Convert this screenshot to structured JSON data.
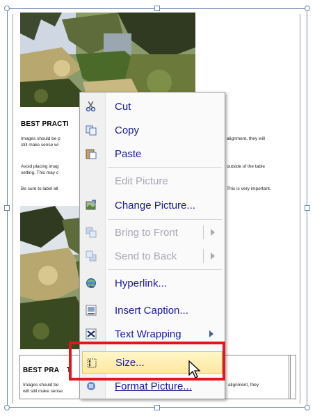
{
  "document": {
    "heading_top": "BEST PRACTI",
    "text_lines_top_left": [
      "Images should be p",
      "still make sense wi",
      "Avoid placing imag",
      "setting. This may c",
      "Be sure to label all"
    ],
    "text_lines_top_right": [
      "alignment, they will",
      "outside of the table",
      "This is very important."
    ],
    "heading_bottom": "BEST PRA",
    "heading_bottom_cell": "T",
    "text_lines_bottom_left": [
      "Images should be",
      "will still make sense"
    ],
    "text_lines_bottom_right": [
      "alignment, they"
    ]
  },
  "context_menu": {
    "items": [
      {
        "label": "Cut",
        "icon": "scissors-icon",
        "enabled": true
      },
      {
        "label": "Copy",
        "icon": "copy-icon",
        "enabled": true
      },
      {
        "label": "Paste",
        "icon": "paste-icon",
        "enabled": true
      },
      {
        "label": "Edit Picture",
        "icon": "",
        "enabled": false
      },
      {
        "label": "Change Picture...",
        "icon": "change-picture-icon",
        "enabled": true
      },
      {
        "label": "Bring to Front",
        "icon": "bring-to-front-icon",
        "enabled": false
      },
      {
        "label": "Send to Back",
        "icon": "send-to-back-icon",
        "enabled": false
      },
      {
        "label": "Hyperlink...",
        "icon": "hyperlink-globe-icon",
        "enabled": true
      },
      {
        "label": "Insert Caption...",
        "icon": "insert-caption-icon",
        "enabled": true
      },
      {
        "label": "Text Wrapping",
        "icon": "text-wrapping-icon",
        "enabled": true
      },
      {
        "label": "Size...",
        "icon": "size-icon",
        "enabled": true,
        "highlighted": true
      },
      {
        "label": "Format Picture...",
        "icon": "format-picture-icon",
        "enabled": true
      }
    ]
  },
  "colors": {
    "menu_text": "#1a1a9a",
    "disabled_text": "#a8a8b8",
    "highlight_border": "#e0181b",
    "selection_frame": "#6c86b6"
  }
}
